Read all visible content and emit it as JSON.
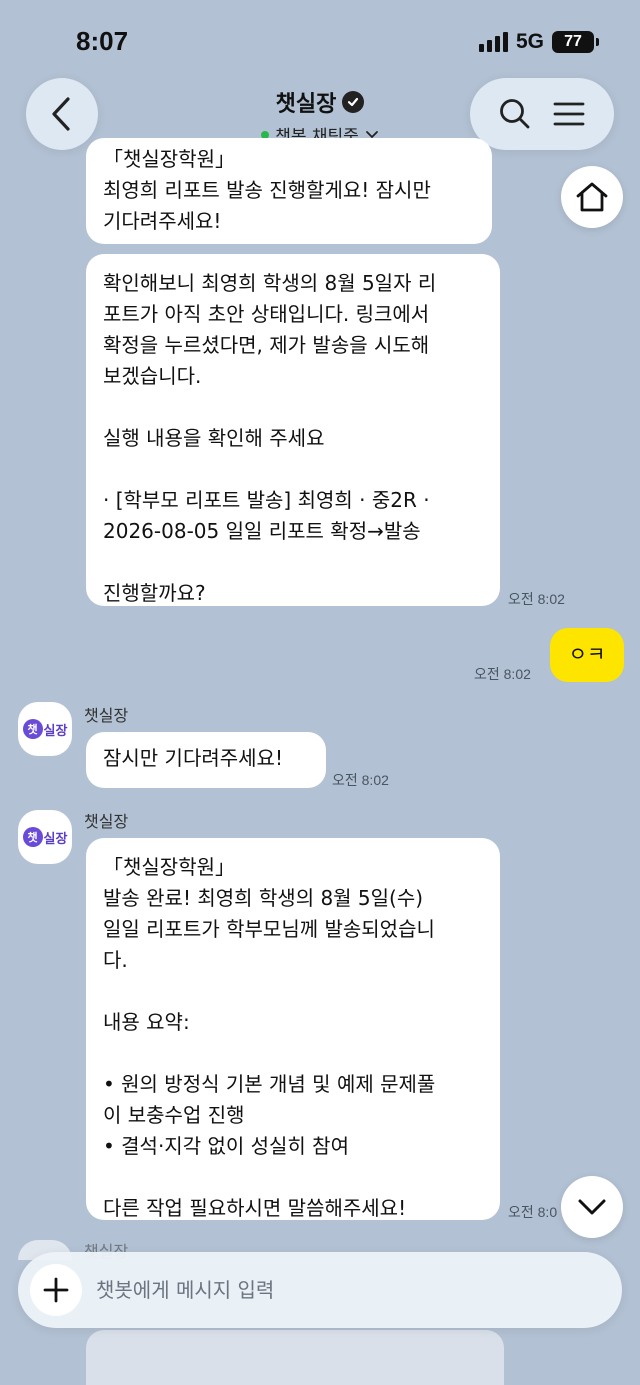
{
  "status": {
    "time": "8:07",
    "network": "5G",
    "battery": "77"
  },
  "header": {
    "title": "챗실장",
    "subtitle": "챗봇 채팅중",
    "icons": [
      "chevron-left-icon",
      "verified-icon",
      "search-icon",
      "menu-icon",
      "home-icon"
    ]
  },
  "messages": [
    {
      "type": "bot",
      "text": "「챗실장학원」\n최영희 리포트 발송 진행할게요! 잠시만\n기다려주세요!"
    },
    {
      "type": "bot",
      "text": "확인해보니 최영희 학생의 8월 5일자 리\n포트가 아직 초안 상태입니다. 링크에서\n확정을 누르셨다면, 제가 발송을 시도해\n보겠습니다.\n\n실행 내용을 확인해 주세요\n\n· [학부모 리포트 발송] 최영희 · 중2R ·\n2026-08-05 일일 리포트 확정→발송\n\n진행할까요?",
      "time": "오전 8:02"
    },
    {
      "type": "me",
      "text": "ㅇㅋ",
      "time": "오전 8:02"
    },
    {
      "type": "bot",
      "sender": "챗실장",
      "text": "잠시만 기다려주세요!",
      "time": "오전 8:02"
    },
    {
      "type": "bot",
      "sender": "챗실장",
      "text": "「챗실장학원」\n발송 완료! 최영희 학생의 8월 5일(수)\n일일 리포트가 학부모님께 발송되었습니\n다.\n\n내용 요약:\n\n• 원의 방정식 기본 개념 및 예제 문제풀\n이 보충수업 진행\n• 결석·지각 없이 성실히 참여\n\n다른 작업 필요하시면 말씀해주세요!",
      "time": "오전 8:0"
    }
  ],
  "avatar_label": {
    "mark": "챗",
    "text": "실장"
  },
  "faded_sender": "챗실장",
  "composer": {
    "placeholder": "챗봇에게 메시지 입력"
  },
  "colors": {
    "background": "#b2c1d3",
    "my_bubble": "#fee500",
    "bot_bubble": "#ffffff",
    "avatar_brand": "#6a4bd8",
    "online_dot": "#28b84a"
  }
}
